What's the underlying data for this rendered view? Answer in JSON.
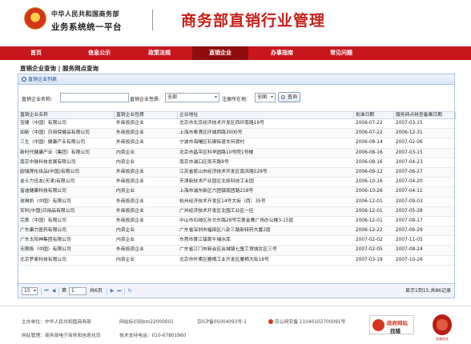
{
  "header": {
    "org_line1": "中华人民共和国商务部",
    "org_line2": "业务系统统一平台",
    "system_title": "商务部直销行业管理"
  },
  "nav": {
    "items": [
      {
        "label": "首页",
        "active": false
      },
      {
        "label": "信息公示",
        "active": false
      },
      {
        "label": "政策法规",
        "active": false
      },
      {
        "label": "直销企业",
        "active": true
      },
      {
        "label": "办事指南",
        "active": false
      },
      {
        "label": "常见问题",
        "active": false
      }
    ]
  },
  "breadcrumb": "直销企业查询 | 服务网点查询",
  "panel": {
    "title": "直销企业列表"
  },
  "filter": {
    "name_label": "直销企业名称:",
    "name_value": "",
    "nature_label": "直销企业性质:",
    "nature_value": "全部",
    "region_label": "注册所在地:",
    "region_value": "全国",
    "query_button": "查询"
  },
  "table": {
    "columns": [
      "直销企业名称",
      "直销企业性质",
      "企业地址",
      "批准日期",
      "服务网点核查备案日期"
    ],
    "rows": [
      [
        "宝健（中国）有限公司",
        "外商投资企业",
        "北京市北京经济技术开发区西环南路16号",
        "2006-07-22",
        "2007-03-15"
      ],
      [
        "如新（中国）日用保健品有限公司",
        "外商投资企业",
        "上海市奉贤区环城西路3000号",
        "2006-07-22",
        "2006-12-31"
      ],
      [
        "三生（中国）健康产业有限公司",
        "外商投资企业",
        "宁波市海曙区石碶街道车何渡村",
        "2006-08-14",
        "2007-02-06"
      ],
      [
        "新时代健康产业（集团）有限公司",
        "内资企业",
        "北京市昌平区科学园路10号院1号楼",
        "2006-08-16",
        "2007-03-15"
      ],
      [
        "南京中脉科技发展有限公司",
        "内资企业",
        "南京市浦口区雨天路9号",
        "2006-08-16",
        "2007-04-23"
      ],
      [
        "欧瑞莲化妆品(中国)有限公司",
        "外商投资企业",
        "江苏省昆山市经济技术开发区南洪路529号",
        "2006-09-12",
        "2007-06-27"
      ],
      [
        "金士力佳友(天津)有限公司",
        "外商投资企业",
        "天津新技术产业园区北辰科技工业园",
        "2006-10-16",
        "2007-04-20"
      ],
      [
        "富迪健康科技有限公司",
        "内资企业",
        "上海市浦东新区六团镇南团路218号",
        "2006-10-26",
        "2007-04-11"
      ],
      [
        "玫琳凯（中国）有限公司",
        "外商投资企业",
        "杭州经济技术开发区14号大街（西）35号",
        "2006-12-01",
        "2007-09-03"
      ],
      [
        "安利(中国)日用品有限公司",
        "外商投资企业",
        "广州经济技术开发区北围工业区一区",
        "2006-12-01",
        "2007-05-28"
      ],
      [
        "完美（中国）有限公司",
        "外商投资企业",
        "中山市石岐区孙文东路28号完美金鹰广场办公楼3-15层",
        "2006-12-01",
        "2007-08-17"
      ],
      [
        "广东康力医药有限公司",
        "内资企业",
        "广东省深圳市福田区八卦三路新特药大厦2层",
        "2006-12-22",
        "2007-06-29"
      ],
      [
        "广东太阳神集团有限公司",
        "内资企业",
        "东莞市黄江镇黄牛埔水库",
        "2007-02-02",
        "2007-11-05"
      ],
      [
        "无限极（中国）有限公司",
        "外商投资企业",
        "广东省江门市新会区会城镇七堡工贸城北区三号",
        "2007-02-05",
        "2007-08-24"
      ],
      [
        "北京罗麦科技有限公司",
        "内资企业",
        "北京市怀柔区雁栖工业开发区雁栖大街18号",
        "2007-03-19",
        "2007-10-26"
      ]
    ]
  },
  "pager": {
    "page_size": "15",
    "page_label_before": "第",
    "current_page": "1",
    "page_label_after": "共6页",
    "info": "显示1到15,共86记录"
  },
  "footer": {
    "sponsor": "主办单位：中华人民共和国商务部",
    "site_code": "网站标识码bm22000001",
    "icp": "京ICP备05004093号-1",
    "police_record": "京公网安备 11040102700091号",
    "manager": "网站管理：商务部电子商务和信息化司",
    "support": "技术支持电话：010-67801960",
    "gov_badge_line1": "政府网站",
    "gov_badge_line2": "找错",
    "seal_caption": "党政机关"
  },
  "colors": {
    "brand_red": "#c8161d",
    "nav_active": "#8f0d0f",
    "panel_border": "#aac4e4",
    "panel_title_text": "#15428b"
  }
}
